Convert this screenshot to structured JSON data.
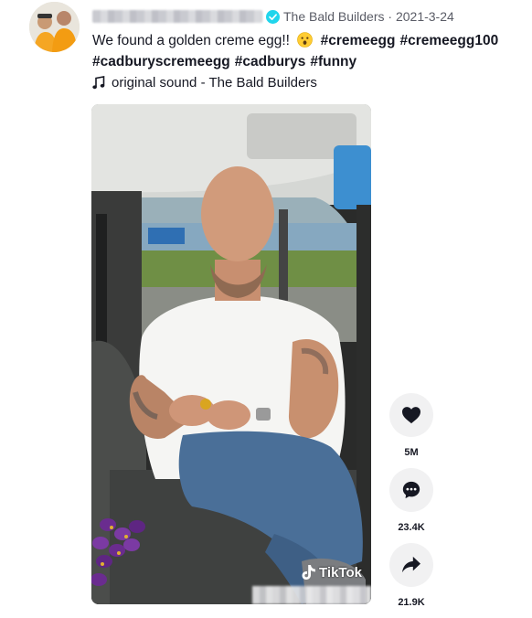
{
  "post": {
    "author_display": "The Bald Builders",
    "date_sep": " · ",
    "date": "2021-3-24",
    "caption_text": "We found a golden creme egg!!",
    "hashtags_line1": [
      "#cremeegg",
      "#cremeegg100"
    ],
    "hashtags_line2": [
      "#cadburyscremeegg",
      "#cadburys",
      "#funny"
    ],
    "music_label": "original sound - The Bald Builders"
  },
  "video": {
    "watermark": "TikTok"
  },
  "actions": [
    {
      "name": "like",
      "icon": "heart-icon",
      "count": "5M"
    },
    {
      "name": "comment",
      "icon": "comment-icon",
      "count": "23.4K"
    },
    {
      "name": "share",
      "icon": "share-arrow-icon",
      "count": "21.9K"
    }
  ],
  "colors": {
    "verified": "#20d5ec",
    "text": "#161823",
    "secondary": "#5a5c66",
    "action_bg": "#f1f1f2"
  }
}
